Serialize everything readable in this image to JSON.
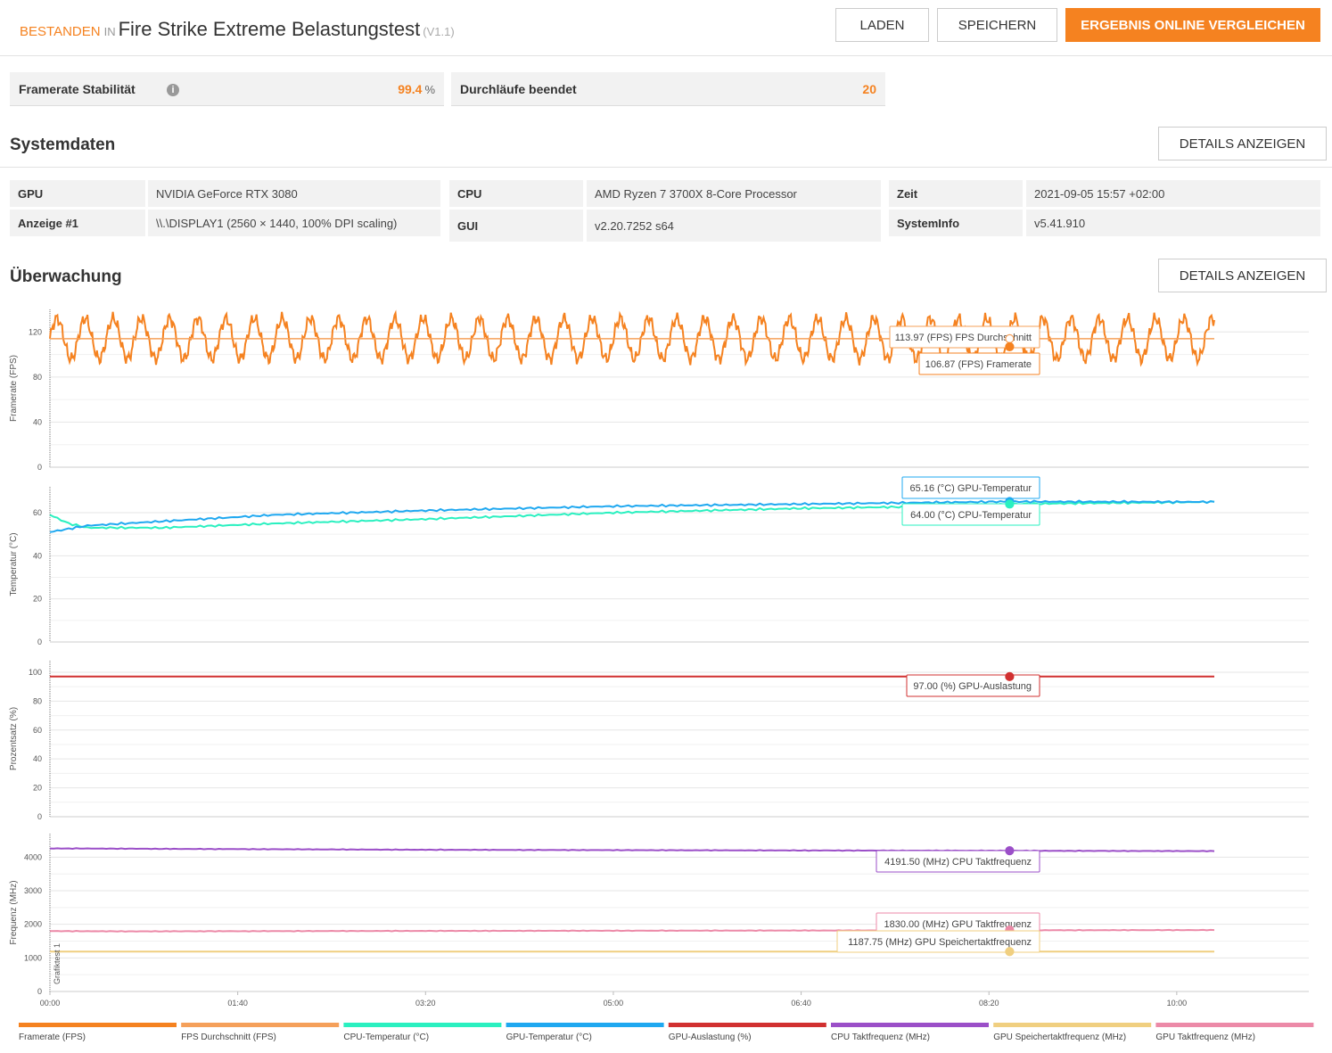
{
  "header": {
    "status": "BESTANDEN",
    "in_word": "IN",
    "test_name": "Fire Strike Extreme Belastungstest",
    "version": "(V1.1)",
    "buttons": {
      "load": "LADEN",
      "save": "SPEICHERN",
      "compare": "ERGEBNIS ONLINE VERGLEICHEN"
    }
  },
  "metrics": {
    "stability": {
      "label": "Framerate Stabilität",
      "value": "99.4",
      "unit": "%"
    },
    "loops": {
      "label": "Durchläufe beendet",
      "value": "20"
    }
  },
  "system": {
    "title": "Systemdaten",
    "details_button": "DETAILS ANZEIGEN",
    "rows": [
      [
        {
          "k": "GPU",
          "v": "NVIDIA GeForce RTX 3080"
        },
        {
          "k": "CPU",
          "v": "AMD Ryzen 7 3700X 8-Core Processor"
        },
        {
          "k": "Zeit",
          "v": "2021-09-05 15:57 +02:00"
        }
      ],
      [
        {
          "k": "Anzeige #1",
          "v": "\\\\.\\DISPLAY1 (2560 × 1440, 100% DPI scaling)"
        },
        {
          "k": "GUI",
          "v": "v2.20.7252 s64"
        },
        {
          "k": "SystemInfo",
          "v": "v5.41.910"
        }
      ]
    ]
  },
  "monitoring": {
    "title": "Überwachung",
    "details_button": "DETAILS ANZEIGEN"
  },
  "colors": {
    "accent": "#f58220",
    "framerate": "#f58220",
    "fps_avg": "#f5a05a",
    "cpu_temp": "#2af0c0",
    "gpu_temp": "#1fa8f0",
    "gpu_load": "#d13030",
    "cpu_clock": "#9b4fc8",
    "gpu_mem_clock": "#f0cf80",
    "gpu_clock": "#ec8aa8"
  },
  "chart_data": {
    "type": "line",
    "x_ticks": [
      "00:00",
      "01:40",
      "03:20",
      "05:00",
      "06:40",
      "08:20",
      "10:00"
    ],
    "x_range_seconds": [
      0,
      620
    ],
    "cursor_time": "08:31",
    "side_label": "Grafiktest 1",
    "panels": [
      {
        "ylabel": "Framerate (FPS)",
        "ylim": [
          0,
          140
        ],
        "yticks": [
          0,
          40,
          80,
          120
        ],
        "series": [
          {
            "name": "Framerate (FPS)",
            "color_key": "framerate",
            "pattern": "oscillating",
            "mean": 114,
            "amplitude": 18,
            "period_s": 15
          },
          {
            "name": "FPS Durchschnitt (FPS)",
            "color_key": "fps_avg",
            "constant": 113.97
          }
        ],
        "tooltips": [
          {
            "text": "113.97 (FPS) FPS Durchschnitt",
            "series": 1,
            "value": 113.97
          },
          {
            "text": "106.87 (FPS) Framerate",
            "series": 0,
            "value": 106.87
          }
        ]
      },
      {
        "ylabel": "Temperatur (°C)",
        "ylim": [
          0,
          72
        ],
        "yticks": [
          0,
          20,
          40,
          60
        ],
        "series": [
          {
            "name": "CPU-Temperatur (°C)",
            "color_key": "cpu_temp",
            "points": [
              [
                0,
                59
              ],
              [
                10,
                55
              ],
              [
                20,
                53
              ],
              [
                60,
                53
              ],
              [
                120,
                55
              ],
              [
                200,
                57
              ],
              [
                300,
                60
              ],
              [
                400,
                62
              ],
              [
                480,
                63
              ],
              [
                510,
                64
              ],
              [
                620,
                65
              ]
            ]
          },
          {
            "name": "GPU-Temperatur (°C)",
            "color_key": "gpu_temp",
            "points": [
              [
                0,
                51
              ],
              [
                20,
                54
              ],
              [
                60,
                56
              ],
              [
                120,
                59
              ],
              [
                200,
                61
              ],
              [
                300,
                63
              ],
              [
                400,
                64
              ],
              [
                510,
                65.16
              ],
              [
                620,
                65
              ]
            ]
          }
        ],
        "tooltips": [
          {
            "text": "65.16 (°C) GPU-Temperatur",
            "series": 1,
            "value": 65.16
          },
          {
            "text": "64.00 (°C) CPU-Temperatur",
            "series": 0,
            "value": 64.0
          }
        ]
      },
      {
        "ylabel": "Prozentsatz (%)",
        "ylim": [
          0,
          108
        ],
        "yticks": [
          0,
          20,
          40,
          60,
          80,
          100
        ],
        "series": [
          {
            "name": "GPU-Auslastung (%)",
            "color_key": "gpu_load",
            "constant": 97
          }
        ],
        "tooltips": [
          {
            "text": "97.00 (%) GPU-Auslastung",
            "series": 0,
            "value": 97.0
          }
        ]
      },
      {
        "ylabel": "Frequenz (MHz)",
        "ylim": [
          0,
          4700
        ],
        "yticks": [
          0,
          1000,
          2000,
          3000,
          4000
        ],
        "series": [
          {
            "name": "CPU Taktfrequenz (MHz)",
            "color_key": "cpu_clock",
            "points": [
              [
                0,
                4260
              ],
              [
                100,
                4240
              ],
              [
                200,
                4220
              ],
              [
                300,
                4210
              ],
              [
                400,
                4200
              ],
              [
                510,
                4191.5
              ],
              [
                620,
                4180
              ]
            ]
          },
          {
            "name": "GPU Taktfrequenz (MHz)",
            "color_key": "gpu_clock",
            "points": [
              [
                0,
                1800
              ],
              [
                40,
                1790
              ],
              [
                150,
                1800
              ],
              [
                620,
                1830
              ]
            ]
          },
          {
            "name": "GPU Speichertaktfrequenz (MHz)",
            "color_key": "gpu_mem_clock",
            "constant": 1187.75
          }
        ],
        "tooltips": [
          {
            "text": "4191.50 (MHz) CPU Taktfrequenz",
            "series": 0,
            "value": 4191.5
          },
          {
            "text": "1830.00 (MHz) GPU Taktfrequenz",
            "series": 1,
            "value": 1830.0
          },
          {
            "text": "1187.75 (MHz) GPU Speichertaktfrequenz",
            "series": 2,
            "value": 1187.75
          }
        ]
      }
    ],
    "legend": [
      {
        "label": "Framerate (FPS)",
        "color_key": "framerate"
      },
      {
        "label": "FPS Durchschnitt (FPS)",
        "color_key": "fps_avg"
      },
      {
        "label": "CPU-Temperatur (°C)",
        "color_key": "cpu_temp"
      },
      {
        "label": "GPU-Temperatur (°C)",
        "color_key": "gpu_temp"
      },
      {
        "label": "GPU-Auslastung (%)",
        "color_key": "gpu_load"
      },
      {
        "label": "CPU Taktfrequenz (MHz)",
        "color_key": "cpu_clock"
      },
      {
        "label": "GPU Speichertaktfrequenz (MHz)",
        "color_key": "gpu_mem_clock"
      },
      {
        "label": "GPU Taktfrequenz (MHz)",
        "color_key": "gpu_clock"
      }
    ]
  }
}
